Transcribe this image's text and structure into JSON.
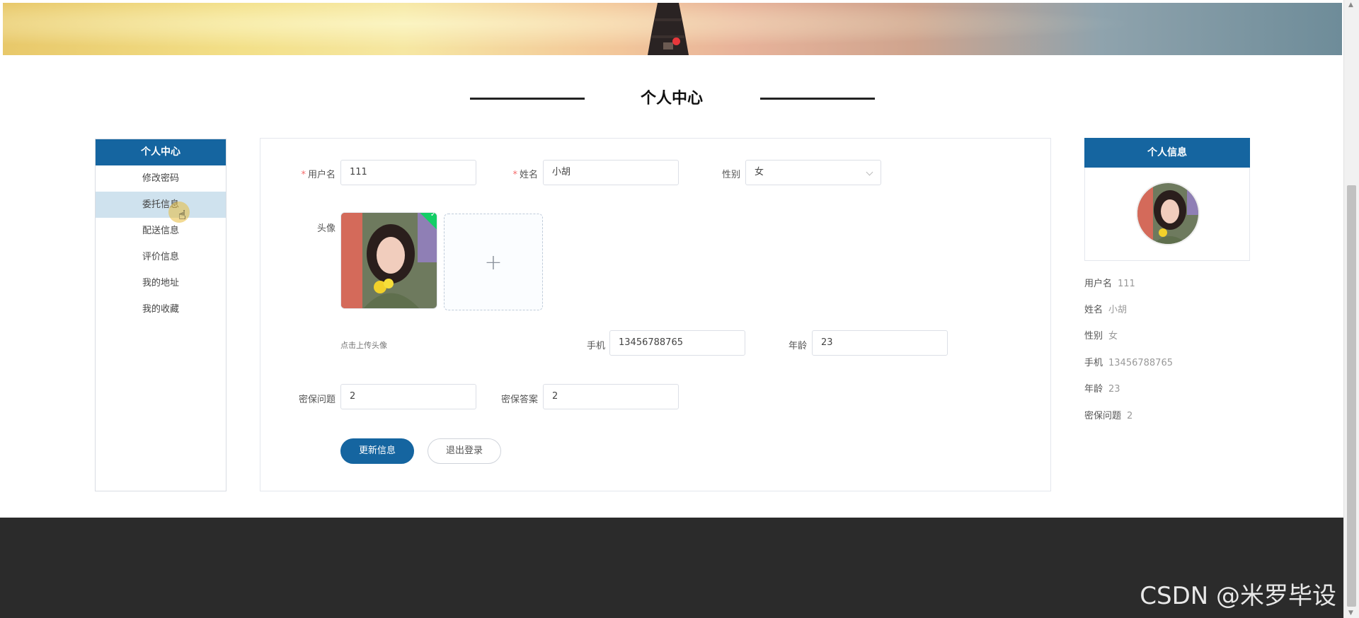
{
  "page": {
    "title": "个人中心"
  },
  "sidebar": {
    "header": "个人中心",
    "items": [
      {
        "label": "修改密码"
      },
      {
        "label": "委托信息"
      },
      {
        "label": "配送信息"
      },
      {
        "label": "评价信息"
      },
      {
        "label": "我的地址"
      },
      {
        "label": "我的收藏"
      }
    ],
    "active_index": 1
  },
  "form": {
    "username": {
      "label": "用户名",
      "value": "111",
      "required": true
    },
    "name": {
      "label": "姓名",
      "value": "小胡",
      "required": true
    },
    "gender": {
      "label": "性别",
      "value": "女"
    },
    "avatar": {
      "label": "头像",
      "tip": "点击上传头像",
      "upload_symbol": "+"
    },
    "phone": {
      "label": "手机",
      "value": "13456788765"
    },
    "age": {
      "label": "年龄",
      "value": "23"
    },
    "security_question": {
      "label": "密保问题",
      "value": "2"
    },
    "security_answer": {
      "label": "密保答案",
      "value": "2"
    },
    "buttons": {
      "update": "更新信息",
      "logout": "退出登录"
    }
  },
  "info_panel": {
    "header": "个人信息",
    "rows": [
      {
        "key": "用户名",
        "value": "111"
      },
      {
        "key": "姓名",
        "value": "小胡"
      },
      {
        "key": "性别",
        "value": "女"
      },
      {
        "key": "手机",
        "value": "13456788765"
      },
      {
        "key": "年龄",
        "value": "23"
      },
      {
        "key": "密保问题",
        "value": "2"
      }
    ]
  },
  "footer": {
    "watermark": "CSDN @米罗毕设"
  },
  "colors": {
    "primary": "#1565a0",
    "active_menu": "#cfe2ee",
    "footer": "#2b2b2b",
    "carousel_dot": "#e8373b",
    "success": "#13ce66"
  },
  "icons": {
    "select_arrow": "chevron-down-icon",
    "upload": "plus-icon",
    "cursor": "hand-pointer-icon",
    "uploaded": "check-icon"
  }
}
